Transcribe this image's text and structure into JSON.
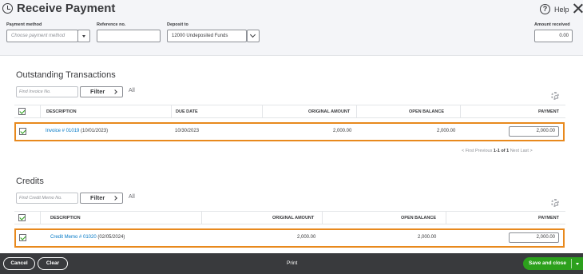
{
  "header": {
    "title": "Receive Payment",
    "help_label": "Help"
  },
  "fields": {
    "payment_method_label": "Payment method",
    "payment_method_placeholder": "Choose payment method",
    "reference_label": "Reference no.",
    "reference_value": "",
    "deposit_label": "Deposit to",
    "deposit_value": "12000 Undeposited Funds",
    "amount_received_label": "Amount received",
    "amount_received_value": "0.00"
  },
  "outstanding": {
    "title": "Outstanding Transactions",
    "find_placeholder": "Find Invoice No.",
    "filter_label": "Filter",
    "all_label": "All",
    "columns": [
      "DESCRIPTION",
      "DUE DATE",
      "ORIGINAL AMOUNT",
      "OPEN BALANCE",
      "PAYMENT"
    ],
    "rows": [
      {
        "link": "Invoice # 01019",
        "date": "(10/01/2023)",
        "due_date": "10/30/2023",
        "original_amount": "2,000.00",
        "open_balance": "2,000.00",
        "payment": "2,000.00",
        "checked": true
      }
    ],
    "pager": {
      "first": "< First",
      "previous": "Previous",
      "range": "1-1 of 1",
      "next": "Next",
      "last": "Last >"
    }
  },
  "credits": {
    "title": "Credits",
    "find_placeholder": "Find Credit Memo No.",
    "filter_label": "Filter",
    "all_label": "All",
    "columns": [
      "DESCRIPTION",
      "ORIGINAL AMOUNT",
      "OPEN BALANCE",
      "PAYMENT"
    ],
    "rows": [
      {
        "link": "Credit Memo # 01020",
        "date": "(02/05/2024)",
        "original_amount": "2,000.00",
        "open_balance": "2,000.00",
        "payment": "2,000.00",
        "checked": true
      }
    ]
  },
  "footer": {
    "cancel_label": "Cancel",
    "clear_label": "Clear",
    "print_label": "Print",
    "save_label": "Save and close"
  },
  "colors": {
    "accent_green": "#2ca01c",
    "highlight_orange": "#e8891d",
    "link_blue": "#0077c5",
    "footer_bg": "#393a3d"
  }
}
